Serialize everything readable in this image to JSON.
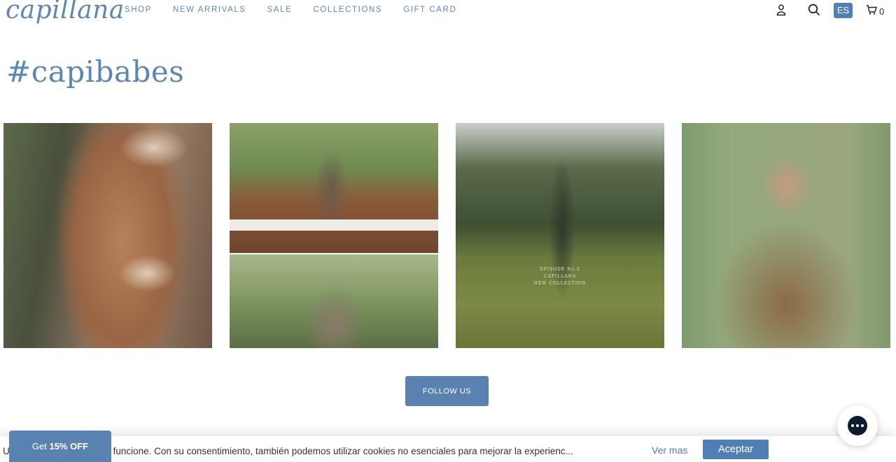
{
  "brand": {
    "logo_text": "capillana"
  },
  "nav": {
    "items": [
      {
        "label": "SHOP"
      },
      {
        "label": "NEW ARRIVALS"
      },
      {
        "label": "SALE"
      },
      {
        "label": "COLLECTIONS"
      },
      {
        "label": "GIFT CARD"
      }
    ]
  },
  "header": {
    "account_icon": "user-icon",
    "search_icon": "search-icon",
    "language": "ES",
    "cart_icon": "cart-icon",
    "cart_count": "0"
  },
  "section": {
    "title": "#capibabes"
  },
  "gallery": {
    "tiles": [
      {
        "subject": "crochet bikini"
      },
      {
        "subject": "model on fence with horses"
      },
      {
        "subject": "striped knit dress in field with horses",
        "caption_lines": [
          "EPISODE  No.2",
          "CAPILLANA",
          "NEW COLLECTION"
        ]
      },
      {
        "subject": "butterfly knit top"
      }
    ]
  },
  "follow_button": {
    "label": "FOLLOW US"
  },
  "cookie": {
    "text": "U                  s para que nuestro sitio funcione. Con su consentimiento, también podemos utilizar cookies no esenciales para mejorar la experienc...",
    "more_link": "Ver mas",
    "accept_label": "Aceptar"
  },
  "promo": {
    "prefix": "Get ",
    "highlight": "15% OFF"
  },
  "chat": {
    "icon": "chat-bubble-icon"
  },
  "colors": {
    "accent": "#5a82b0",
    "brand": "#5e86b3",
    "lang_badge": "#4f7fb5"
  }
}
